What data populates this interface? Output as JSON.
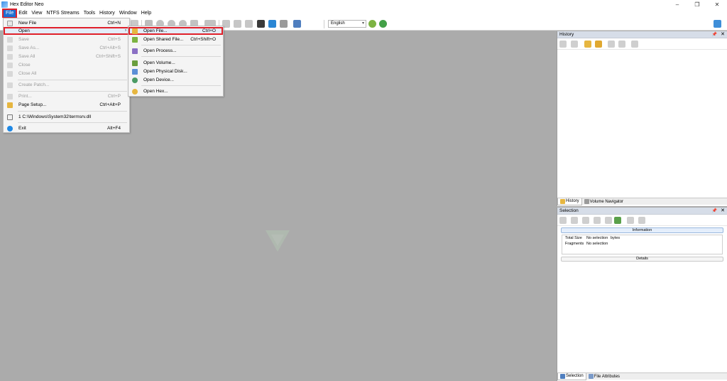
{
  "window": {
    "title": "Hex Editor Neo",
    "controls": [
      "–",
      "❐",
      "✕"
    ]
  },
  "menubar": [
    "File",
    "Edit",
    "View",
    "NTFS Streams",
    "Tools",
    "History",
    "Window",
    "Help"
  ],
  "toolbar": {
    "language": "English"
  },
  "file_menu": {
    "items": [
      {
        "label": "New File",
        "shortcut": "Ctrl+N",
        "icon": "new-file-icon",
        "enabled": true
      },
      {
        "label": "Open",
        "shortcut": "",
        "icon": "open-icon",
        "enabled": true,
        "submenu": true
      },
      {
        "label": "Save",
        "shortcut": "Ctrl+S",
        "icon": "save-icon",
        "enabled": false
      },
      {
        "label": "Save As...",
        "shortcut": "Ctrl+Alt+S",
        "icon": "save-as-icon",
        "enabled": false
      },
      {
        "label": "Save All",
        "shortcut": "Ctrl+Shift+S",
        "icon": "save-all-icon",
        "enabled": false
      },
      {
        "label": "Close",
        "shortcut": "",
        "icon": "close-icon",
        "enabled": false
      },
      {
        "label": "Close All",
        "shortcut": "",
        "icon": "close-all-icon",
        "enabled": false
      },
      {
        "label": "Create Patch...",
        "shortcut": "",
        "icon": "patch-icon",
        "enabled": false
      },
      {
        "label": "Print...",
        "shortcut": "Ctrl+P",
        "icon": "print-icon",
        "enabled": false
      },
      {
        "label": "Page Setup...",
        "shortcut": "Ctrl+Alt+P",
        "icon": "page-setup-icon",
        "enabled": true
      },
      {
        "label": "1 C:\\Windows\\System32\\termsrv.dll",
        "shortcut": "",
        "icon": "recent-file-icon",
        "enabled": true
      },
      {
        "label": "Exit",
        "shortcut": "Alt+F4",
        "icon": "power-icon",
        "enabled": true
      }
    ]
  },
  "open_submenu": {
    "items": [
      {
        "label": "Open File...",
        "shortcut": "Ctrl+O",
        "icon": "open-file-icon"
      },
      {
        "label": "Open Shared File...",
        "shortcut": "Ctrl+Shift+O",
        "icon": "open-shared-icon"
      },
      {
        "label": "Open Process...",
        "shortcut": "",
        "icon": "process-icon"
      },
      {
        "label": "Open Volume...",
        "shortcut": "",
        "icon": "volume-icon"
      },
      {
        "label": "Open Physical Disk...",
        "shortcut": "",
        "icon": "disk-icon"
      },
      {
        "label": "Open Device...",
        "shortcut": "",
        "icon": "device-icon"
      },
      {
        "label": "Open Hex...",
        "shortcut": "",
        "icon": "hex-icon"
      }
    ]
  },
  "history_panel": {
    "title": "History",
    "tabs": [
      "History",
      "Volume Navigator"
    ]
  },
  "selection_panel": {
    "title": "Selection",
    "information": "Information",
    "rows": [
      {
        "key": "Total Size",
        "value": "No selection",
        "unit": "bytes"
      },
      {
        "key": "Fragments",
        "value": "No selection",
        "unit": ""
      }
    ],
    "details": "Details",
    "tabs": [
      "Selection",
      "File Attributes"
    ]
  },
  "colors": {
    "accent": "#1e6fd1",
    "highlight_border": "#e0202a",
    "workspace": "#ababab"
  }
}
